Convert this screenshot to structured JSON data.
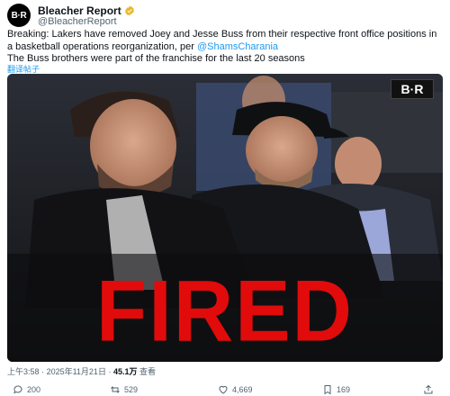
{
  "author": {
    "avatar_text": "B·R",
    "name": "Bleacher Report",
    "handle": "@BleacherReport"
  },
  "tweet": {
    "text_before_mention": "Breaking: Lakers have removed Joey and Jesse Buss from their respective front office positions in a basketball operations reorganization, per ",
    "mention": "@ShamsCharania",
    "text2": "The Buss brothers were part of the franchise for the last 20 seasons",
    "translate_label": "翻译帖子"
  },
  "media": {
    "logo_text": "B·R",
    "overlay_text": "FIRED"
  },
  "meta": {
    "time": "上午3:58",
    "date": "2025年11月21日",
    "views": "45.1万",
    "views_label": "查看"
  },
  "actions": {
    "replies": "200",
    "reposts": "529",
    "likes": "4,669",
    "bookmarks": "169"
  },
  "colors": {
    "accent": "#1d9bf0",
    "fired": "#e10b0b"
  }
}
